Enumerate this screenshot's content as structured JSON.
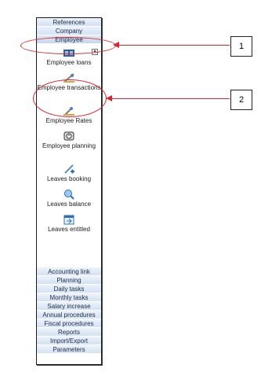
{
  "top_tabs": [
    "References",
    "Company",
    "Employee"
  ],
  "items": [
    {
      "label": "Employee loans",
      "icon": "loans-icon"
    },
    {
      "label": "Employee transactions",
      "icon": "transactions-icon"
    },
    {
      "label": "Employee Rates",
      "icon": "rates-icon"
    },
    {
      "label": "Employee planning",
      "icon": "planning-icon"
    },
    {
      "label": "Leaves booking",
      "icon": "leaves-booking-icon"
    },
    {
      "label": "Leaves balance",
      "icon": "leaves-balance-icon"
    },
    {
      "label": "Leaves entitled",
      "icon": "leaves-entitled-icon"
    }
  ],
  "bottom_tabs": [
    "Accounting link",
    "Planning",
    "Daily tasks",
    "Monthly tasks",
    "Salary increase",
    "Annual procedures",
    "Fiscal procedures",
    "Reports",
    "Import/Export",
    "Parameters"
  ],
  "callouts": {
    "one": "1",
    "two": "2"
  },
  "colors": {
    "annotation_red": "#d4272e",
    "tab_blue": "#d3e1f2"
  }
}
